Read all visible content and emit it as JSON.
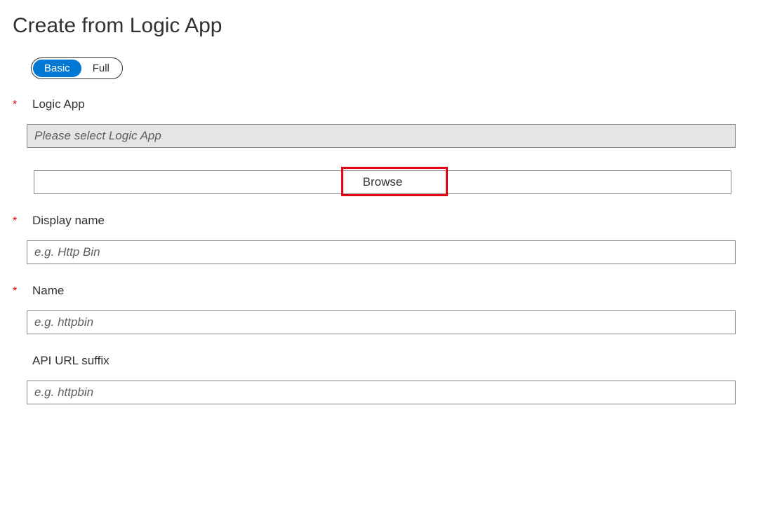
{
  "title": "Create from Logic App",
  "toggle": {
    "basic": "Basic",
    "full": "Full"
  },
  "fields": {
    "logicApp": {
      "label": "Logic App",
      "placeholder": "Please select Logic App",
      "browse": "Browse"
    },
    "displayName": {
      "label": "Display name",
      "placeholder": "e.g. Http Bin"
    },
    "name": {
      "label": "Name",
      "placeholder": "e.g. httpbin"
    },
    "apiUrlSuffix": {
      "label": "API URL suffix",
      "placeholder": "e.g. httpbin"
    }
  },
  "requiredMarker": "*"
}
